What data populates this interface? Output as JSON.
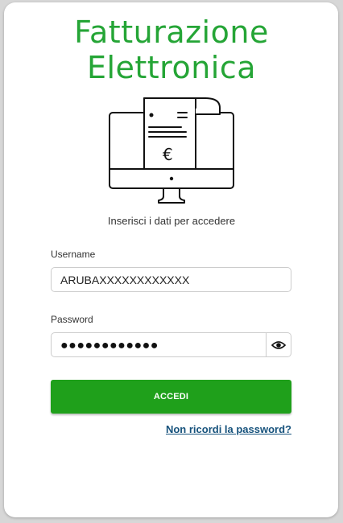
{
  "brand": {
    "title_line1": "Fatturazione",
    "title_line2": "Elettronica",
    "accent_color": "#25a536",
    "illustration_icon": "monitor-invoice-euro-icon",
    "invoice_symbol": "€"
  },
  "login": {
    "subtitle": "Inserisci i dati per accedere",
    "username_label": "Username",
    "username_value": "ARUBAXXXXXXXXXXXX",
    "password_label": "Password",
    "password_masked": "●●●●●●●●●●●●",
    "toggle_visibility_icon": "eye-icon",
    "submit_label": "ACCEDI",
    "submit_color": "#1fa01b",
    "forgot_link": "Non ricordi la password?",
    "link_color": "#16527c"
  }
}
